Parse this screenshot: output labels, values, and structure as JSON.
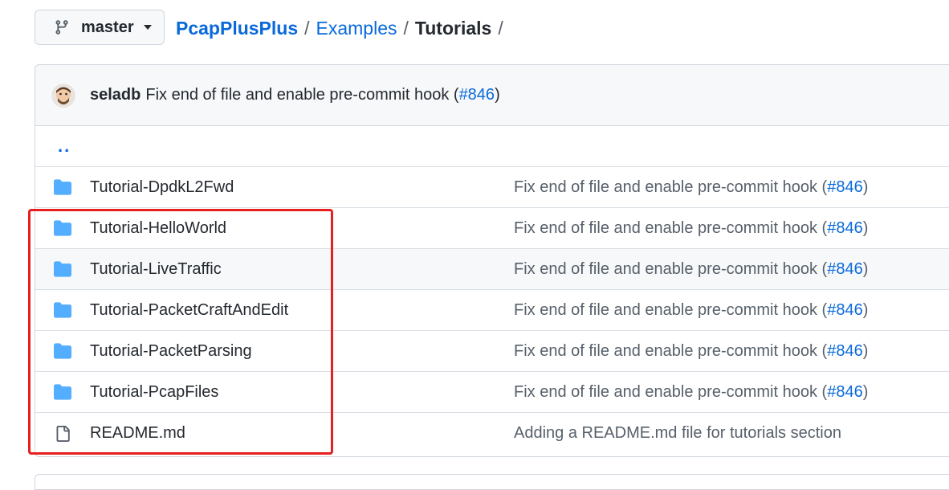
{
  "branch": {
    "name": "master",
    "icon": "git-branch-icon"
  },
  "breadcrumb": {
    "root": "PcapPlusPlus",
    "sep1": "/",
    "mid": "Examples",
    "sep2": "/",
    "current": "Tutorials",
    "sep3": "/"
  },
  "commit": {
    "author": "seladb",
    "message": "Fix end of file and enable pre-commit hook (",
    "pr": "#846",
    "close": ")"
  },
  "parent_link": "..",
  "files": [
    {
      "type": "folder",
      "name": "Tutorial-DpdkL2Fwd",
      "msg": "Fix end of file and enable pre-commit hook (",
      "pr": "#846",
      "close": ")"
    },
    {
      "type": "folder",
      "name": "Tutorial-HelloWorld",
      "msg": "Fix end of file and enable pre-commit hook (",
      "pr": "#846",
      "close": ")"
    },
    {
      "type": "folder",
      "name": "Tutorial-LiveTraffic",
      "msg": "Fix end of file and enable pre-commit hook (",
      "pr": "#846",
      "close": ")"
    },
    {
      "type": "folder",
      "name": "Tutorial-PacketCraftAndEdit",
      "msg": "Fix end of file and enable pre-commit hook (",
      "pr": "#846",
      "close": ")"
    },
    {
      "type": "folder",
      "name": "Tutorial-PacketParsing",
      "msg": "Fix end of file and enable pre-commit hook (",
      "pr": "#846",
      "close": ")"
    },
    {
      "type": "folder",
      "name": "Tutorial-PcapFiles",
      "msg": "Fix end of file and enable pre-commit hook (",
      "pr": "#846",
      "close": ")"
    },
    {
      "type": "file",
      "name": "README.md",
      "msg": "Adding a README.md file for tutorials section",
      "pr": "",
      "close": ""
    }
  ],
  "colors": {
    "link": "#0969da",
    "folder": "#54aeff",
    "highlight": "#e5201e"
  }
}
